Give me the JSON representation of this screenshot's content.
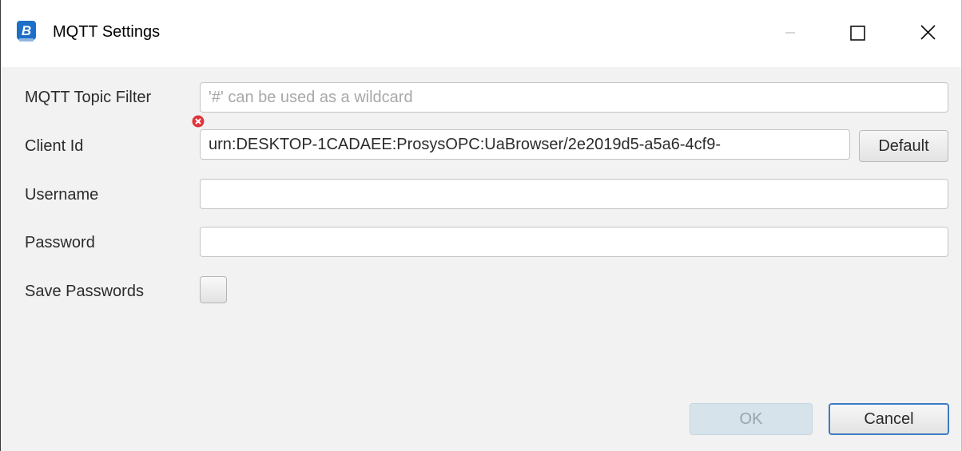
{
  "window": {
    "title": "MQTT Settings",
    "app_icon": "prosys-browser-icon",
    "controls": [
      "minimize-icon",
      "maximize-icon",
      "close-icon"
    ]
  },
  "form": {
    "topic_filter": {
      "label": "MQTT Topic Filter",
      "value": "",
      "placeholder": "'#' can be used as a wildcard",
      "has_error": true
    },
    "client_id": {
      "label": "Client Id",
      "value": "urn:DESKTOP-1CADAEE:ProsysOPC:UaBrowser/2e2019d5-a5a6-4cf9-",
      "default_label": "Default"
    },
    "username": {
      "label": "Username",
      "value": ""
    },
    "password": {
      "label": "Password",
      "value": ""
    },
    "save_passwords": {
      "label": "Save Passwords",
      "checked": false
    }
  },
  "footer": {
    "ok_label": "OK",
    "ok_enabled": false,
    "cancel_label": "Cancel"
  },
  "colors": {
    "accent": "#3d7bc2",
    "app_icon_blue": "#1e6fc7",
    "error_red": "#e0353a"
  }
}
